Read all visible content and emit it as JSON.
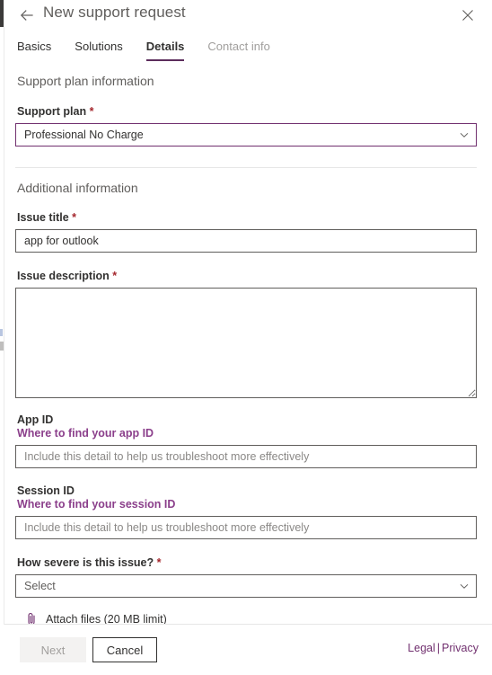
{
  "header": {
    "title": "New support request",
    "back_icon": "arrow-left-icon",
    "close_icon": "close-icon"
  },
  "tabs": [
    {
      "label": "Basics",
      "state": "enabled"
    },
    {
      "label": "Solutions",
      "state": "enabled"
    },
    {
      "label": "Details",
      "state": "active"
    },
    {
      "label": "Contact info",
      "state": "disabled"
    }
  ],
  "sections": {
    "support_plan": {
      "heading": "Support plan information",
      "plan_label": "Support plan",
      "plan_required": "*",
      "plan_value": "Professional No Charge",
      "caret_icon": "chevron-down-icon"
    },
    "additional": {
      "heading": "Additional information",
      "issue_title_label": "Issue title",
      "issue_title_required": "*",
      "issue_title_value": "app for outlook",
      "issue_description_label": "Issue description",
      "issue_description_required": "*",
      "issue_description_value": "",
      "app_id_label": "App ID",
      "app_id_help_link": "Where to find your app ID",
      "app_id_placeholder": "Include this detail to help us troubleshoot more effectively",
      "app_id_value": "",
      "session_id_label": "Session ID",
      "session_id_help_link": "Where to find your session ID",
      "session_id_placeholder": "Include this detail to help us troubleshoot more effectively",
      "session_id_value": "",
      "severity_label": "How severe is this issue?",
      "severity_required": "*",
      "severity_value": "Select",
      "attach_icon": "paperclip-icon",
      "attach_label": "Attach files (20 MB limit)"
    }
  },
  "footer": {
    "next_label": "Next",
    "cancel_label": "Cancel",
    "legal_label": "Legal",
    "separator": "|",
    "privacy_label": "Privacy"
  },
  "colors": {
    "accent_purple": "#71306f",
    "tab_underline": "#5c2d5c",
    "link_purple": "#8b3f8b",
    "required_red": "#a4262c"
  }
}
